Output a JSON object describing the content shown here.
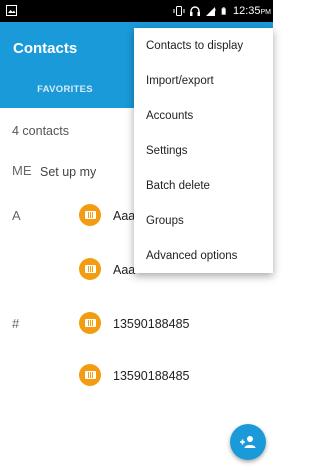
{
  "status_bar": {
    "time": "12:35",
    "ampm": "PM",
    "icons": [
      "gallery-notification-icon",
      "vibrate-icon",
      "headset-icon",
      "signal-icon",
      "battery-icon"
    ]
  },
  "app_bar": {
    "title": "Contacts",
    "tabs": [
      {
        "label": "FAVORITES"
      }
    ]
  },
  "contacts": {
    "count_label": "4 contacts",
    "me_section": {
      "letter": "ME",
      "text": "Set up my"
    },
    "sections": [
      {
        "letter": "A",
        "names": [
          "Aaa",
          "Aaa"
        ]
      },
      {
        "letter": "#",
        "names": [
          "13590188485",
          "13590188485"
        ]
      }
    ]
  },
  "menu": {
    "items": [
      {
        "label": "Contacts to display"
      },
      {
        "label": "Import/export"
      },
      {
        "label": "Accounts"
      },
      {
        "label": "Settings"
      },
      {
        "label": "Batch delete"
      },
      {
        "label": "Groups"
      },
      {
        "label": "Advanced options"
      }
    ]
  },
  "fab": {
    "icon": "add-contact-icon"
  },
  "colors": {
    "primary": "#1a9ad9",
    "avatar": "#f39c12",
    "status_bar": "#000000"
  }
}
